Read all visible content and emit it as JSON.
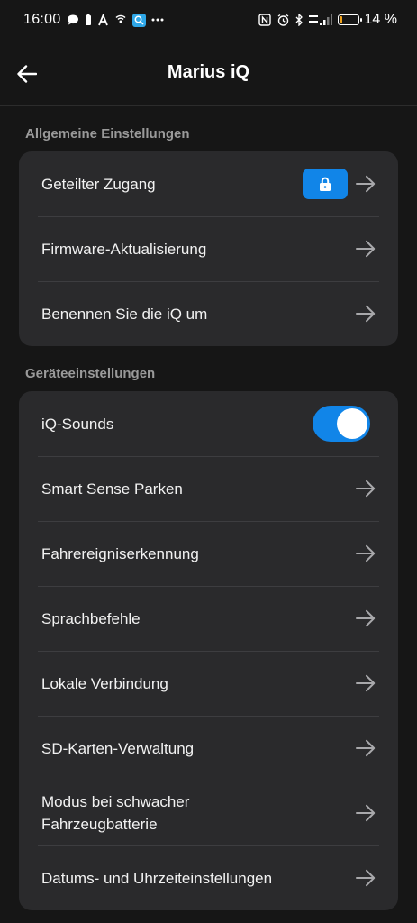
{
  "status_bar": {
    "time": "16:00",
    "battery_percent": "14 %",
    "battery_level": 0.14,
    "icons_left": [
      "message-icon",
      "battery-saver-icon",
      "font-icon",
      "hotspot-icon",
      "search-app-icon",
      "more-dots-icon"
    ],
    "icons_right": [
      "nfc-icon",
      "alarm-icon",
      "bluetooth-icon",
      "signal-icon",
      "battery-icon"
    ]
  },
  "header": {
    "title": "Marius iQ",
    "back_icon": "arrow-left-icon"
  },
  "sections": [
    {
      "title": "Allgemeine Einstellungen",
      "items": [
        {
          "label": "Geteilter Zugang",
          "badge": "lock-icon"
        },
        {
          "label": "Firmware-Aktualisierung"
        },
        {
          "label": "Benennen Sie die iQ um"
        }
      ]
    },
    {
      "title": "Geräteeinstellungen",
      "items": [
        {
          "label": "iQ-Sounds",
          "toggle_on": true
        },
        {
          "label": "Smart Sense Parken"
        },
        {
          "label": "Fahrereigniserkennung"
        },
        {
          "label": "Sprachbefehle"
        },
        {
          "label": "Lokale Verbindung"
        },
        {
          "label": "SD-Karten-Verwaltung"
        },
        {
          "label": "Modus bei schwacher Fahrzeugbatterie"
        },
        {
          "label": "Datums- und Uhrzeiteinstellungen"
        }
      ]
    }
  ],
  "colors": {
    "accent": "#1185e8",
    "card": "#2a2a2c",
    "background": "#161616",
    "section_title": "#9a9a9a"
  }
}
